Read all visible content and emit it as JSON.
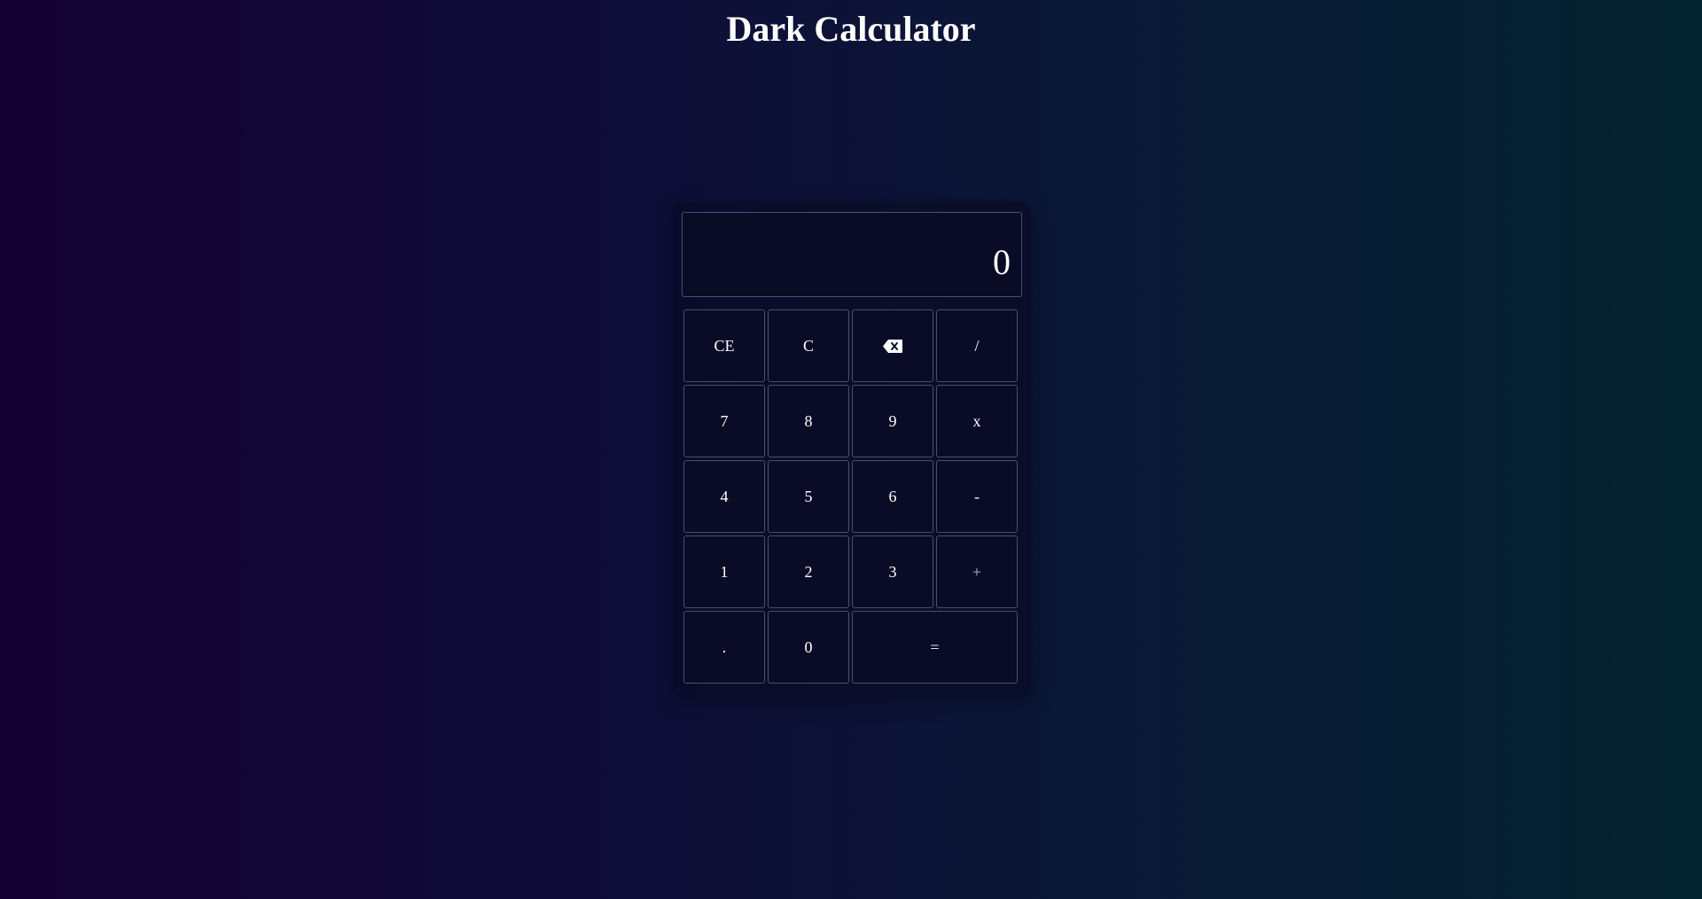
{
  "page": {
    "title": "Dark Calculator"
  },
  "calculator": {
    "display_value": "0",
    "keys": {
      "ce": "CE",
      "c": "C",
      "backspace_icon": "backspace-icon",
      "divide": "/",
      "seven": "7",
      "eight": "8",
      "nine": "9",
      "multiply": "x",
      "four": "4",
      "five": "5",
      "six": "6",
      "minus": "-",
      "one": "1",
      "two": "2",
      "three": "3",
      "plus": "+",
      "decimal": ".",
      "zero": "0",
      "equals": "="
    }
  },
  "colors": {
    "background_start": "#140033",
    "background_end": "#03232f",
    "key_border": "#4a5068",
    "text": "#ffffff"
  }
}
